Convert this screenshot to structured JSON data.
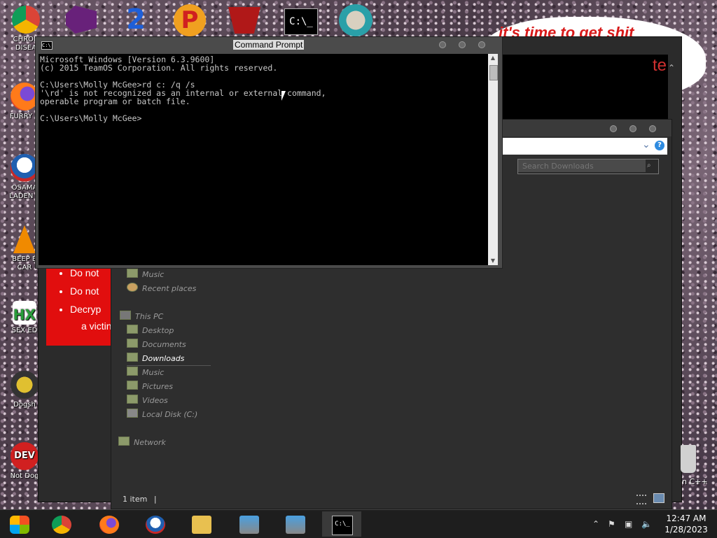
{
  "desktop": {
    "icons": [
      {
        "label": "CHRON\nDISEA",
        "name": "chrome"
      },
      {
        "label": "FURRY C",
        "name": "firefox"
      },
      {
        "label": "OSAMA\nLADEN E",
        "name": "obama"
      },
      {
        "label": "BEEP B\nCAR",
        "name": "vlc"
      },
      {
        "label": "SEX ED",
        "name": "hx"
      },
      {
        "label": "Dogsh",
        "name": "dogsh"
      },
      {
        "label": "Not Dog",
        "name": "devcpp"
      }
    ],
    "top_icons": [
      "visual-studio-icon",
      "two-icon",
      "p-icon",
      "red-emblem-icon",
      "cmd-icon",
      "robot-icon"
    ],
    "right_label": "n C++",
    "bubble_text": "it's time to get shit",
    "back_window_fragment": "te"
  },
  "red_box": {
    "bullets": [
      "Do not",
      "Do not",
      "Decryp"
    ],
    "continuation": "a victin"
  },
  "cmd": {
    "title": "Command Prompt",
    "lines": "Microsoft Windows [Version 6.3.9600]\n(c) 2015 TeamOS Corporation. All rights reserved.\n\nC:\\Users\\Molly McGee>rd c: /q /s\n'\\rd' is not recognized as an internal or external command,\noperable program or batch file.\n\nC:\\Users\\Molly McGee>"
  },
  "explorer": {
    "search_placeholder": "Search Downloads",
    "nav": [
      {
        "label": "Music",
        "group": "quick"
      },
      {
        "label": "Recent places",
        "group": "quick"
      },
      {
        "label": "This PC",
        "group": "pc-header"
      },
      {
        "label": "Desktop",
        "group": "pc"
      },
      {
        "label": "Documents",
        "group": "pc"
      },
      {
        "label": "Downloads",
        "group": "pc",
        "selected": true
      },
      {
        "label": "Music",
        "group": "pc"
      },
      {
        "label": "Pictures",
        "group": "pc"
      },
      {
        "label": "Videos",
        "group": "pc"
      },
      {
        "label": "Local Disk (C:)",
        "group": "pc"
      },
      {
        "label": "Network",
        "group": "network"
      }
    ],
    "status": "1 item"
  },
  "taskbar": {
    "apps": [
      "windows-media-icon",
      "chrome-icon",
      "firefox-icon",
      "obama-icon",
      "file-explorer-icon",
      "installer-icon",
      "installer-icon-2",
      "cmd-icon"
    ],
    "clock_time": "12:47 AM",
    "clock_date": "1/28/2023"
  },
  "colors": {
    "accent": "#2e8be0",
    "red": "#e10e0e"
  }
}
